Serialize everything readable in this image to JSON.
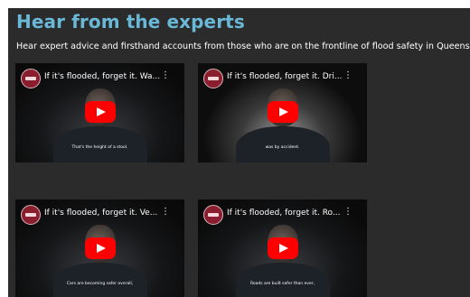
{
  "section": {
    "title": "Hear from the experts",
    "intro": "Hear expert advice and firsthand accounts from those who are on the frontline of flood safety in Queensland."
  },
  "videos": [
    {
      "title": "If it's flooded, forget it. Wa...",
      "caption": "That's the height of a stool.",
      "icon": "play-icon"
    },
    {
      "title": "If it's flooded, forget it. Dri...",
      "caption": "was by accident.",
      "icon": "play-icon"
    },
    {
      "title": "If it's flooded, forget it. Ve...",
      "caption": "Cars are becoming safer overall,",
      "icon": "play-icon"
    },
    {
      "title": "If it's flooded, forget it. Ro...",
      "caption": "Roads are built safer than ever,",
      "icon": "play-icon"
    }
  ],
  "colors": {
    "panel_bg": "#2b2b2b",
    "title": "#6ab8d8",
    "play_button": "#ff0000",
    "channel_logo": "#8a1e2e"
  }
}
